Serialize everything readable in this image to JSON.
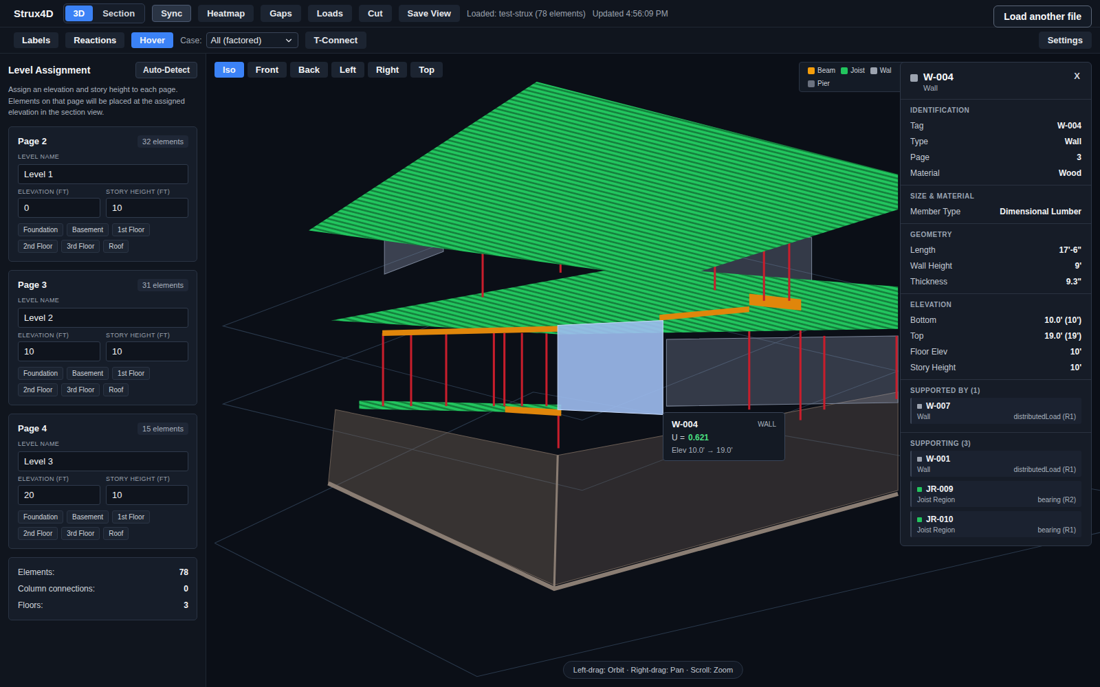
{
  "app": {
    "logo": "Strux4D"
  },
  "mode_tabs": [
    {
      "label": "3D",
      "selected": true
    },
    {
      "label": "Section",
      "selected": false
    }
  ],
  "toolbar_buttons": [
    {
      "label": "Sync",
      "active": true
    },
    {
      "label": "Heatmap",
      "active": false
    },
    {
      "label": "Gaps",
      "active": false
    },
    {
      "label": "Loads",
      "active": false
    },
    {
      "label": "Cut",
      "active": false
    },
    {
      "label": "Save View",
      "active": false
    }
  ],
  "status": {
    "loaded": "Loaded: test-strux (78 elements)",
    "updated": "Updated 4:56:09 PM"
  },
  "load_button": "Load another file",
  "toggles": [
    {
      "label": "Labels",
      "selected": false
    },
    {
      "label": "Reactions",
      "selected": false
    },
    {
      "label": "Hover",
      "selected": true
    }
  ],
  "case": {
    "label": "Case:",
    "value": "All (factored)"
  },
  "t_connect": "T-Connect",
  "settings": "Settings",
  "sidebar": {
    "title": "Level Assignment",
    "auto_detect": "Auto-Detect",
    "description": "Assign an elevation and story height to each page. Elements on that page will be placed at the assigned elevation in the section view.",
    "field_labels": {
      "name": "LEVEL NAME",
      "elevation": "ELEVATION (FT)",
      "story": "STORY HEIGHT (FT)"
    },
    "presets": [
      "Foundation",
      "Basement",
      "1st Floor",
      "2nd Floor",
      "3rd Floor",
      "Roof"
    ],
    "pages": [
      {
        "title": "Page 2",
        "count": "32 elements",
        "name": "Level 1",
        "elevation": "0",
        "story_height": "10"
      },
      {
        "title": "Page 3",
        "count": "31 elements",
        "name": "Level 2",
        "elevation": "10",
        "story_height": "10"
      },
      {
        "title": "Page 4",
        "count": "15 elements",
        "name": "Level 3",
        "elevation": "20",
        "story_height": "10"
      }
    ],
    "stats": [
      {
        "label": "Elements:",
        "value": "78"
      },
      {
        "label": "Column connections:",
        "value": "0"
      },
      {
        "label": "Floors:",
        "value": "3"
      }
    ]
  },
  "view_buttons": [
    {
      "label": "Iso",
      "selected": true
    },
    {
      "label": "Front",
      "selected": false
    },
    {
      "label": "Back",
      "selected": false
    },
    {
      "label": "Left",
      "selected": false
    },
    {
      "label": "Right",
      "selected": false
    },
    {
      "label": "Top",
      "selected": false
    }
  ],
  "legend": [
    {
      "label": "Beam",
      "color": "#f59e0b"
    },
    {
      "label": "Joist",
      "color": "#22c55e"
    },
    {
      "label": "Wal",
      "color": "#9ca3af"
    },
    {
      "label": "Pier",
      "color": "#6b7280"
    }
  ],
  "tooltip": {
    "tag": "W-004",
    "kind": "WALL",
    "u_label": "U =",
    "u_value": "0.621",
    "elev": "Elev 10.0' → 19.0'"
  },
  "details": {
    "tag": "W-004",
    "type": "Wall",
    "close": "X",
    "sections": [
      {
        "title": "IDENTIFICATION",
        "rows": [
          {
            "label": "Tag",
            "value": "W-004"
          },
          {
            "label": "Type",
            "value": "Wall"
          },
          {
            "label": "Page",
            "value": "3"
          },
          {
            "label": "Material",
            "value": "Wood"
          }
        ]
      },
      {
        "title": "SIZE & MATERIAL",
        "rows": [
          {
            "label": "Member Type",
            "value": "Dimensional Lumber"
          }
        ]
      },
      {
        "title": "GEOMETRY",
        "rows": [
          {
            "label": "Length",
            "value": "17'-6\""
          },
          {
            "label": "Wall Height",
            "value": "9'"
          },
          {
            "label": "Thickness",
            "value": "9.3\""
          }
        ]
      },
      {
        "title": "ELEVATION",
        "rows": [
          {
            "label": "Bottom",
            "value": "10.0' (10')"
          },
          {
            "label": "Top",
            "value": "19.0' (19')"
          },
          {
            "label": "Floor Elev",
            "value": "10'"
          },
          {
            "label": "Story Height",
            "value": "10'"
          }
        ]
      }
    ],
    "relations": [
      {
        "title": "SUPPORTED BY (1)",
        "items": [
          {
            "tag": "W-007",
            "type": "Wall",
            "load": "distributedLoad (R1)",
            "color": "#9ca3af"
          }
        ]
      },
      {
        "title": "SUPPORTING (3)",
        "items": [
          {
            "tag": "W-001",
            "type": "Wall",
            "load": "distributedLoad (R1)",
            "color": "#9ca3af"
          },
          {
            "tag": "JR-009",
            "type": "Joist Region",
            "load": "bearing (R2)",
            "color": "#22c55e"
          },
          {
            "tag": "JR-010",
            "type": "Joist Region",
            "load": "bearing (R1)",
            "color": "#22c55e"
          }
        ]
      }
    ]
  },
  "hint": "Left-drag: Orbit · Right-drag: Pan · Scroll: Zoom"
}
